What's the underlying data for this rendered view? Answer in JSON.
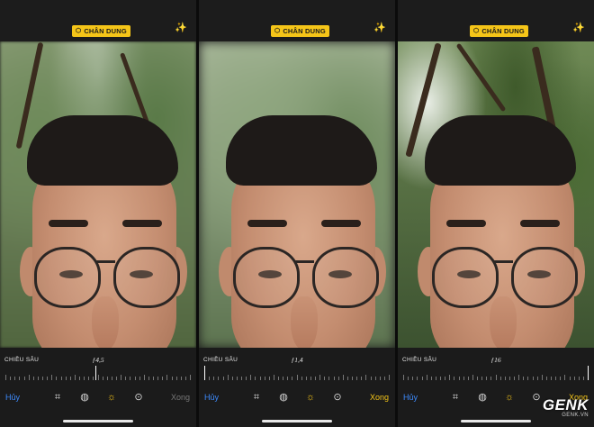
{
  "panels": [
    {
      "mode_badge": "CHÂN DUNG",
      "depth_label": "CHIỀU SÂU",
      "aperture": "ƒ4,5",
      "aperture_level": 0.49,
      "cancel": "Hủy",
      "done": "Xong",
      "done_active": false
    },
    {
      "mode_badge": "CHÂN DUNG",
      "depth_label": "CHIỀU SÂU",
      "aperture": "ƒ1,4",
      "aperture_level": 0.0,
      "cancel": "Hủy",
      "done": "Xong",
      "done_active": true
    },
    {
      "mode_badge": "CHÂN DUNG",
      "depth_label": "CHIỀU SÂU",
      "aperture": "ƒ16",
      "aperture_level": 1.0,
      "cancel": "Hủy",
      "done": "Xong",
      "done_active": true
    }
  ],
  "watermark": {
    "logo": "GENK",
    "site": "GENK.VN"
  },
  "icons": {
    "mode_badge": "cube-icon",
    "top_right": "magic-wand-icon",
    "tools": [
      "crop-icon",
      "filters-icon",
      "adjust-icon",
      "more-icon"
    ],
    "effects": [
      "portrait-lighting-cube-icon"
    ]
  },
  "colors": {
    "accent": "#f5c518",
    "cancel": "#3d8bfd",
    "toolbar": "#1b1b1b"
  }
}
